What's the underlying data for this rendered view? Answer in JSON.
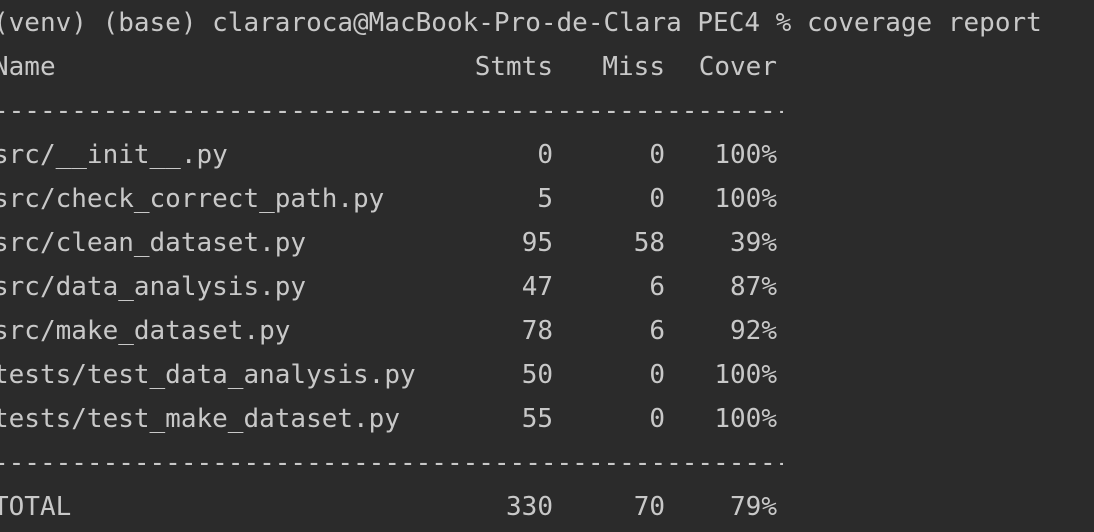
{
  "terminal": {
    "prompt_line": "(venv) (base) clararoca@MacBook-Pro-de-Clara PEC4 % coverage report",
    "header": {
      "name": "Name",
      "stmts": "Stmts",
      "miss": "Miss",
      "cover": "Cover"
    },
    "separator": "---------------------------------------------------",
    "rows": [
      {
        "name": "src/__init__.py",
        "stmts": "0",
        "miss": "0",
        "cover": "100%"
      },
      {
        "name": "src/check_correct_path.py",
        "stmts": "5",
        "miss": "0",
        "cover": "100%"
      },
      {
        "name": "src/clean_dataset.py",
        "stmts": "95",
        "miss": "58",
        "cover": "39%"
      },
      {
        "name": "src/data_analysis.py",
        "stmts": "47",
        "miss": "6",
        "cover": "87%"
      },
      {
        "name": "src/make_dataset.py",
        "stmts": "78",
        "miss": "6",
        "cover": "92%"
      },
      {
        "name": "tests/test_data_analysis.py",
        "stmts": "50",
        "miss": "0",
        "cover": "100%"
      },
      {
        "name": "tests/test_make_dataset.py",
        "stmts": "55",
        "miss": "0",
        "cover": "100%"
      }
    ],
    "total": {
      "name": "TOTAL",
      "stmts": "330",
      "miss": "70",
      "cover": "79%"
    }
  }
}
